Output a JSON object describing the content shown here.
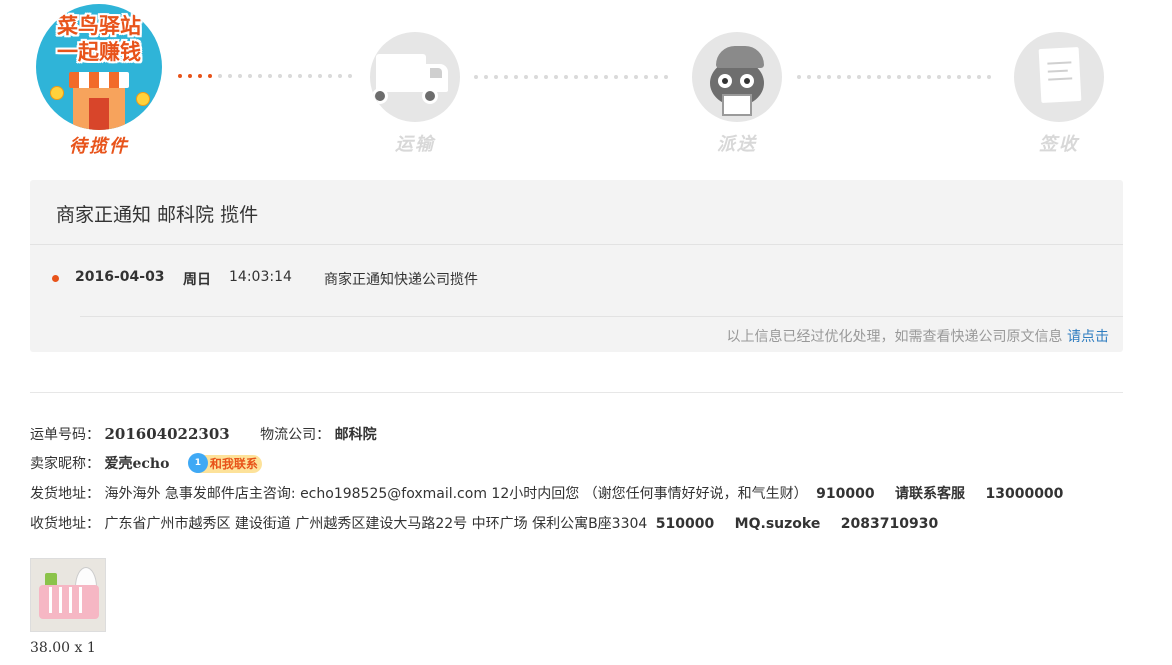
{
  "logo": {
    "line1": "菜鸟驿站",
    "line2": "一起赚钱"
  },
  "steps": [
    {
      "label": "待揽件",
      "state": "active"
    },
    {
      "label": "运输",
      "state": "inactive"
    },
    {
      "label": "派送",
      "state": "inactive"
    },
    {
      "label": "签收",
      "state": "inactive"
    }
  ],
  "tracking": {
    "title": "商家正通知 邮科院 揽件",
    "events": [
      {
        "date": "2016-04-03",
        "weekday": "周日",
        "time": "14:03:14",
        "desc": "商家正通知快递公司揽件"
      }
    ],
    "note": "以上信息已经过优化处理，如需查看快递公司原文信息",
    "note_link": "请点击"
  },
  "order": {
    "waybill_label": "运单号码：",
    "waybill_no": "201604022303",
    "carrier_label": "物流公司：",
    "carrier": "邮科院",
    "seller_label": "卖家昵称：",
    "seller": "爱壳echo",
    "contact_label": "和我联系",
    "contact_badge": "1",
    "ship_label": "发货地址：",
    "ship_addr": "海外海外 急事发邮件店主咨询: echo198525@foxmail.com 12小时内回您 （谢您任何事情好好说，和气生财）",
    "ship_zip": "910000",
    "ship_name": "请联系客服",
    "ship_phone": "13000000",
    "recv_label": "收货地址：",
    "recv_addr": "广东省广州市越秀区 建设街道 广州越秀区建设大马路22号 中环广场 保利公寓B座3304",
    "recv_zip": "510000",
    "recv_name": "MQ.suzoke",
    "recv_phone": "2083710930"
  },
  "product": {
    "price_qty": "38.00 x 1"
  },
  "colors": {
    "accent": "#e8531a",
    "link": "#2f7dc0",
    "panel_bg": "#f3f3f3",
    "inactive": "#d8d8d8"
  },
  "icons": [
    "cainiao-shop-logo-icon",
    "truck-icon",
    "courier-icon",
    "receipt-icon",
    "contact-bubble-icon"
  ]
}
